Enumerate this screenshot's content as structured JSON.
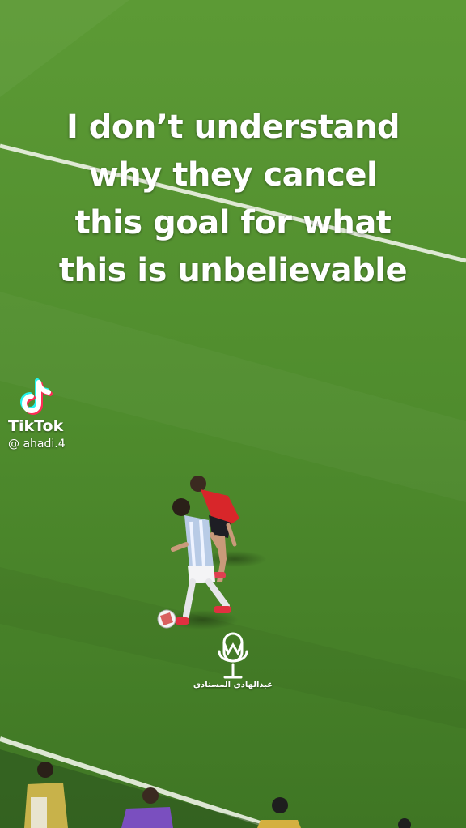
{
  "caption": {
    "lines": [
      "I don’t understand",
      "why they cancel",
      "this goal for what",
      "this is unbelievable"
    ]
  },
  "tiktok": {
    "icon": "tiktok-logo-icon",
    "brand": "TikTok",
    "username": "@ ahadi.4"
  },
  "watermark": {
    "icon": "microphone-logo-icon",
    "text": "عبدالهادي المستادي"
  },
  "colors": {
    "pitch": "#4f8a2c",
    "caption": "#ffffff",
    "red_kit": "#d8262a",
    "sky_blue_kit": "#b8cbe6"
  }
}
